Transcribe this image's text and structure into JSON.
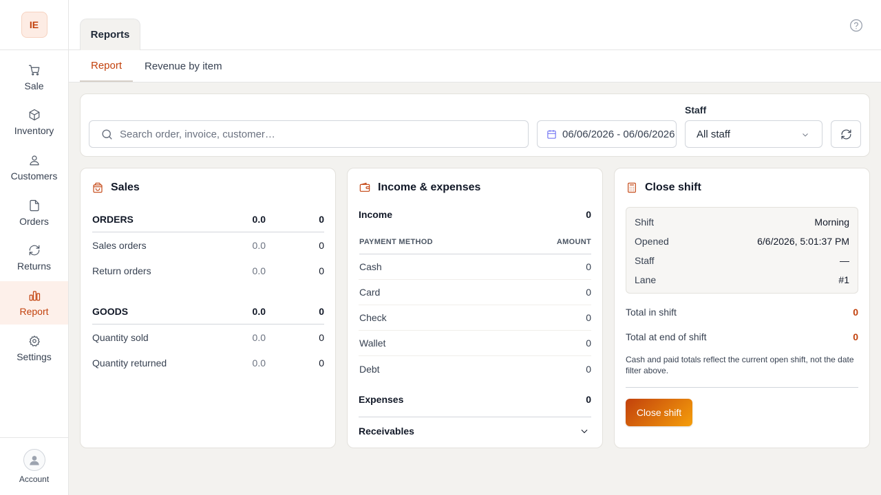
{
  "app": {
    "logo_text": "IE"
  },
  "sidebar": {
    "items": [
      {
        "label": "Sale",
        "icon": "cart-icon"
      },
      {
        "label": "Inventory",
        "icon": "box-icon"
      },
      {
        "label": "Customers",
        "icon": "user-icon"
      },
      {
        "label": "Orders",
        "icon": "file-icon"
      },
      {
        "label": "Returns",
        "icon": "refresh-icon"
      },
      {
        "label": "Report",
        "icon": "bar-chart-icon",
        "active": true
      },
      {
        "label": "Settings",
        "icon": "gear-icon"
      }
    ],
    "account_label": "Account"
  },
  "header": {
    "page_tab": "Reports",
    "help_icon": "help-circle-icon"
  },
  "subtabs": [
    {
      "label": "Report",
      "active": true
    },
    {
      "label": "Revenue by item",
      "active": false
    }
  ],
  "filters": {
    "search_placeholder": "Search order, invoice, customer…",
    "date_range": "06/06/2026 - 06/06/2026",
    "staff_label": "Staff",
    "staff_value": "All staff"
  },
  "sales": {
    "title": "Sales",
    "orders_header": {
      "label": "ORDERS",
      "v1": "0.0",
      "v2": "0"
    },
    "orders": [
      {
        "label": "Sales orders",
        "v1": "0.0",
        "v2": "0"
      },
      {
        "label": "Return orders",
        "v1": "0.0",
        "v2": "0"
      }
    ],
    "goods_header": {
      "label": "GOODS",
      "v1": "0.0",
      "v2": "0"
    },
    "goods": [
      {
        "label": "Quantity sold",
        "v1": "0.0",
        "v2": "0"
      },
      {
        "label": "Quantity returned",
        "v1": "0.0",
        "v2": "0"
      }
    ]
  },
  "income": {
    "title": "Income & expenses",
    "income_label": "Income",
    "income_value": "0",
    "col_method": "PAYMENT METHOD",
    "col_amount": "AMOUNT",
    "methods": [
      {
        "label": "Cash",
        "amount": "0"
      },
      {
        "label": "Card",
        "amount": "0"
      },
      {
        "label": "Check",
        "amount": "0"
      },
      {
        "label": "Wallet",
        "amount": "0"
      },
      {
        "label": "Debt",
        "amount": "0"
      }
    ],
    "expenses_label": "Expenses",
    "expenses_value": "0",
    "receivables_label": "Receivables"
  },
  "shift": {
    "title": "Close shift",
    "details": [
      {
        "label": "Shift",
        "value": "Morning"
      },
      {
        "label": "Opened",
        "value": "6/6/2026, 5:01:37 PM"
      },
      {
        "label": "Staff",
        "value": "—"
      },
      {
        "label": "Lane",
        "value": "#1"
      }
    ],
    "total_in_shift_label": "Total in shift",
    "total_in_shift_value": "0",
    "total_end_label": "Total at end of shift",
    "total_end_value": "0",
    "note": "Cash and paid totals reflect the current open shift, not the date filter above.",
    "button_label": "Close shift"
  },
  "colors": {
    "accent": "#c2410c",
    "accent_light": "#f59e0b",
    "background": "#f3f2ef"
  }
}
